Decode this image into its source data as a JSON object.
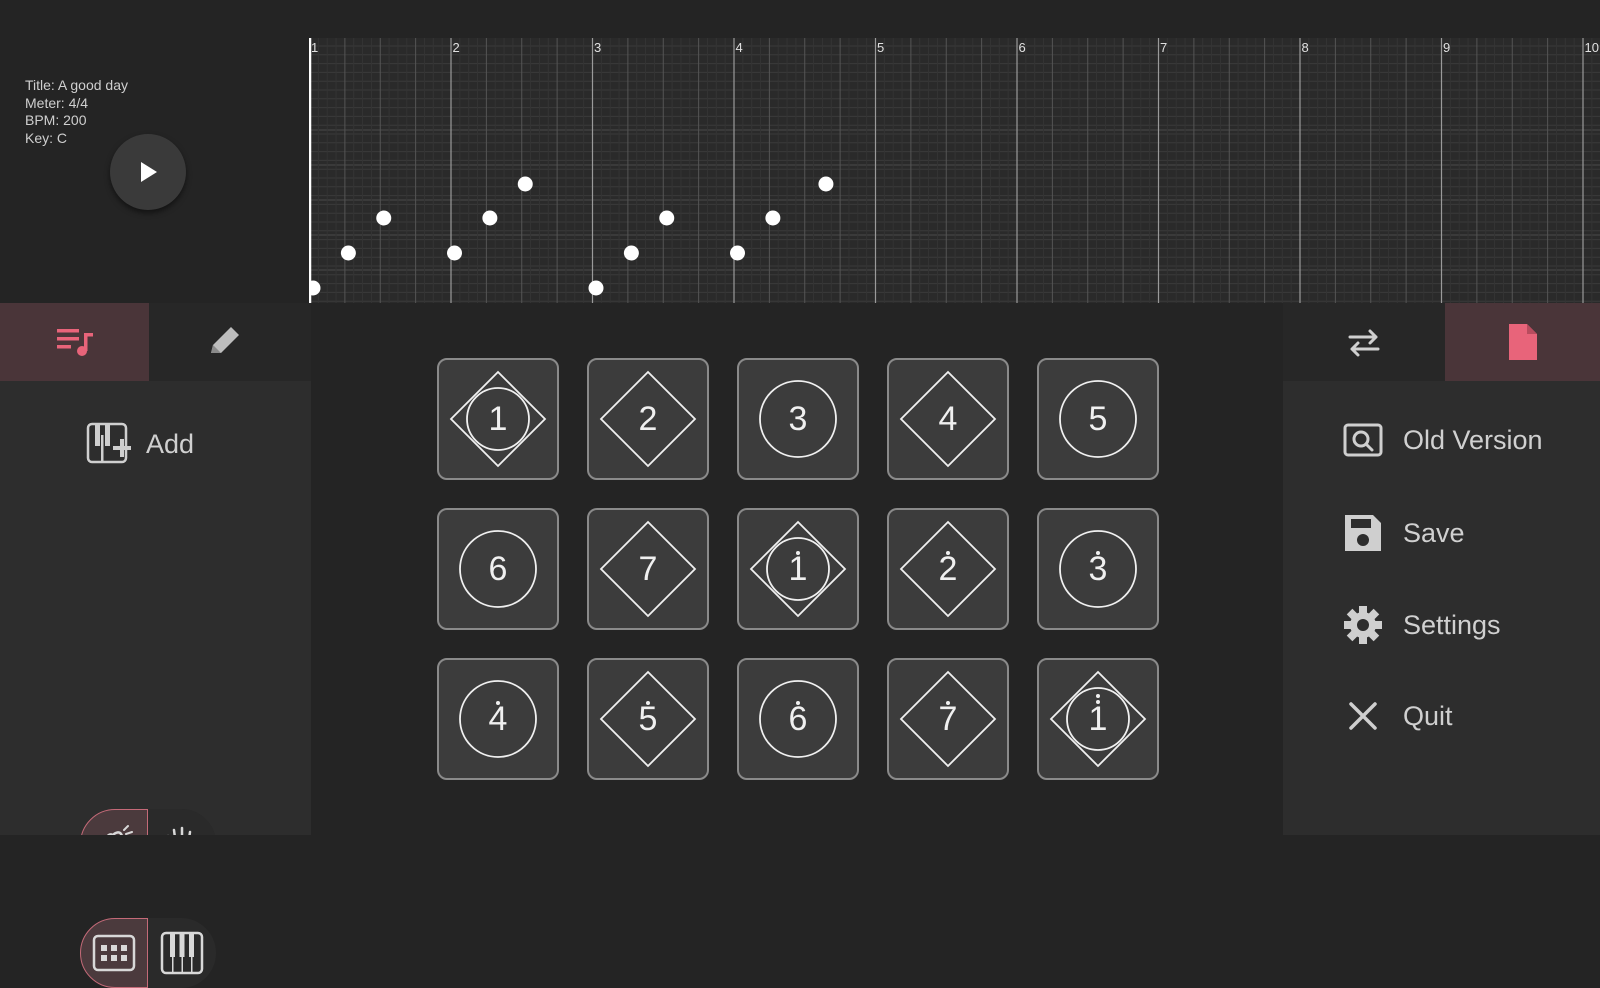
{
  "song": {
    "title": "Title: A good day",
    "meter": "Meter: 4/4",
    "bpm": "BPM: 200",
    "key": "Key: C"
  },
  "timeline": {
    "bar_labels": [
      "1",
      "2",
      "3",
      "4",
      "5",
      "6",
      "7",
      "8",
      "9",
      "10"
    ],
    "notes": [
      {
        "beat": 0,
        "pitch": 0
      },
      {
        "beat": 1,
        "pitch": 1
      },
      {
        "beat": 2,
        "pitch": 2
      },
      {
        "beat": 4,
        "pitch": 1
      },
      {
        "beat": 5,
        "pitch": 2
      },
      {
        "beat": 6,
        "pitch": 3
      },
      {
        "beat": 8,
        "pitch": 0
      },
      {
        "beat": 9,
        "pitch": 1
      },
      {
        "beat": 10,
        "pitch": 2
      },
      {
        "beat": 12,
        "pitch": 1
      },
      {
        "beat": 13,
        "pitch": 2
      },
      {
        "beat": 14.5,
        "pitch": 3
      }
    ]
  },
  "left_panel": {
    "tabs": [
      {
        "icon": "music-list-icon",
        "selected": true
      },
      {
        "icon": "pencil-icon",
        "selected": false
      }
    ],
    "add_label": "Add",
    "hand_toggle": {
      "selected": "pinch-hand-icon",
      "options": [
        "pinch-hand-icon",
        "open-hand-icon"
      ]
    },
    "layout_toggle": {
      "selected": "grid-icon",
      "options": [
        "grid-icon",
        "piano-icon"
      ]
    }
  },
  "pads": [
    {
      "note": "1",
      "dot": "none",
      "shape": "both"
    },
    {
      "note": "2",
      "dot": "none",
      "shape": "diamond"
    },
    {
      "note": "3",
      "dot": "none",
      "shape": "circle"
    },
    {
      "note": "4",
      "dot": "none",
      "shape": "diamond"
    },
    {
      "note": "5",
      "dot": "none",
      "shape": "circle"
    },
    {
      "note": "6",
      "dot": "none",
      "shape": "circle"
    },
    {
      "note": "7",
      "dot": "none",
      "shape": "diamond"
    },
    {
      "note": "1",
      "dot": "above",
      "shape": "both"
    },
    {
      "note": "2",
      "dot": "above",
      "shape": "diamond"
    },
    {
      "note": "3",
      "dot": "above",
      "shape": "circle"
    },
    {
      "note": "4",
      "dot": "above",
      "shape": "circle"
    },
    {
      "note": "5",
      "dot": "above",
      "shape": "diamond"
    },
    {
      "note": "6",
      "dot": "above",
      "shape": "circle"
    },
    {
      "note": "7",
      "dot": "above",
      "shape": "diamond"
    },
    {
      "note": "1",
      "dot": "double",
      "shape": "both"
    }
  ],
  "right_panel": {
    "tabs": [
      {
        "icon": "swap-arrows-icon",
        "selected": false
      },
      {
        "icon": "file-icon",
        "selected": true
      }
    ],
    "menu": {
      "old_version": "Old Version",
      "save": "Save",
      "settings": "Settings",
      "quit": "Quit"
    }
  },
  "colors": {
    "accent": "#e8647a",
    "background": "#242424",
    "panel": "#2d2d2d"
  }
}
